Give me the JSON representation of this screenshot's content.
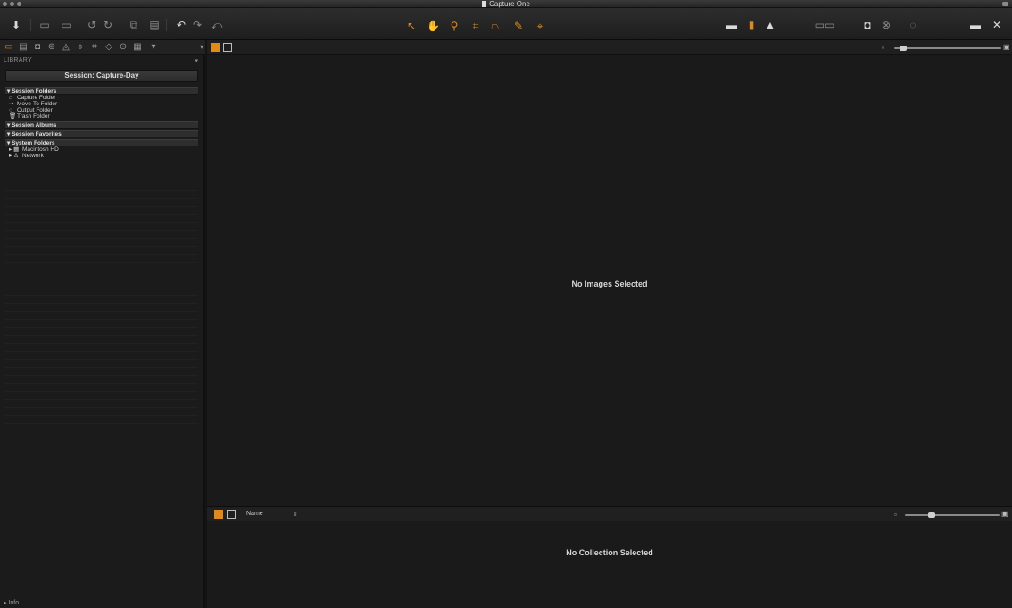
{
  "window": {
    "title": "Capture One"
  },
  "toolbar": {
    "left_buttons": [
      "import-icon",
      "capture-icon",
      "grid-icon",
      "rotate-left-icon",
      "rotate-right-icon",
      "copy-icon",
      "delete-icon",
      "undo-icon",
      "redo-icon",
      "reset-icon"
    ],
    "cursor_tools": [
      "select-icon",
      "pan-icon",
      "loupe-icon",
      "crop-icon",
      "keystone-icon",
      "brush-icon",
      "picker-icon"
    ],
    "right_buttons": [
      "viewer-icon",
      "camera-icon",
      "exposure-warning-icon",
      "grid-overlay-icon",
      "proof-icon",
      "capture-pilot-icon",
      "info-icon",
      "settings-icon",
      "tools-icon"
    ]
  },
  "left_panel": {
    "tool_tabs": [
      "library-tab",
      "capture-tab",
      "lens-tab",
      "color-tab",
      "exposure-tab",
      "detail-tab",
      "composition-tab",
      "adjustments-tab",
      "metadata-tab",
      "output-tab",
      "batch-tab"
    ],
    "library_label": "LIBRARY",
    "library_menu": "▾",
    "session_title": "Session: Capture-Day",
    "sections": [
      {
        "label": "Session Folders",
        "items": [
          {
            "icon": "⌂",
            "label": "Capture Folder"
          },
          {
            "icon": "⇢",
            "label": "Move-To Folder"
          },
          {
            "icon": "○",
            "label": "Output Folder"
          },
          {
            "icon": "🗑",
            "label": "Trash Folder"
          }
        ]
      },
      {
        "label": "Session Albums",
        "items": []
      },
      {
        "label": "Session Favorites",
        "items": []
      },
      {
        "label": "System Folders",
        "items": [
          {
            "icon": "▸ ▦",
            "label": "Macintosh HD"
          },
          {
            "icon": "▸ ♙",
            "label": "Network"
          }
        ]
      }
    ],
    "info_label": "▸ Info"
  },
  "viewer": {
    "empty_message": "No Images Selected",
    "zoom_min_icon": "▫",
    "zoom_max_icon": "▣"
  },
  "browser": {
    "sort_label": "Name",
    "sort_arrow": "⇕",
    "empty_message": "No Collection Selected",
    "thumb_min_icon": "▫",
    "thumb_max_icon": "▣"
  },
  "colors": {
    "accent": "#e08a1e",
    "background": "#1a1a1a",
    "panel": "#1b1b1b"
  }
}
